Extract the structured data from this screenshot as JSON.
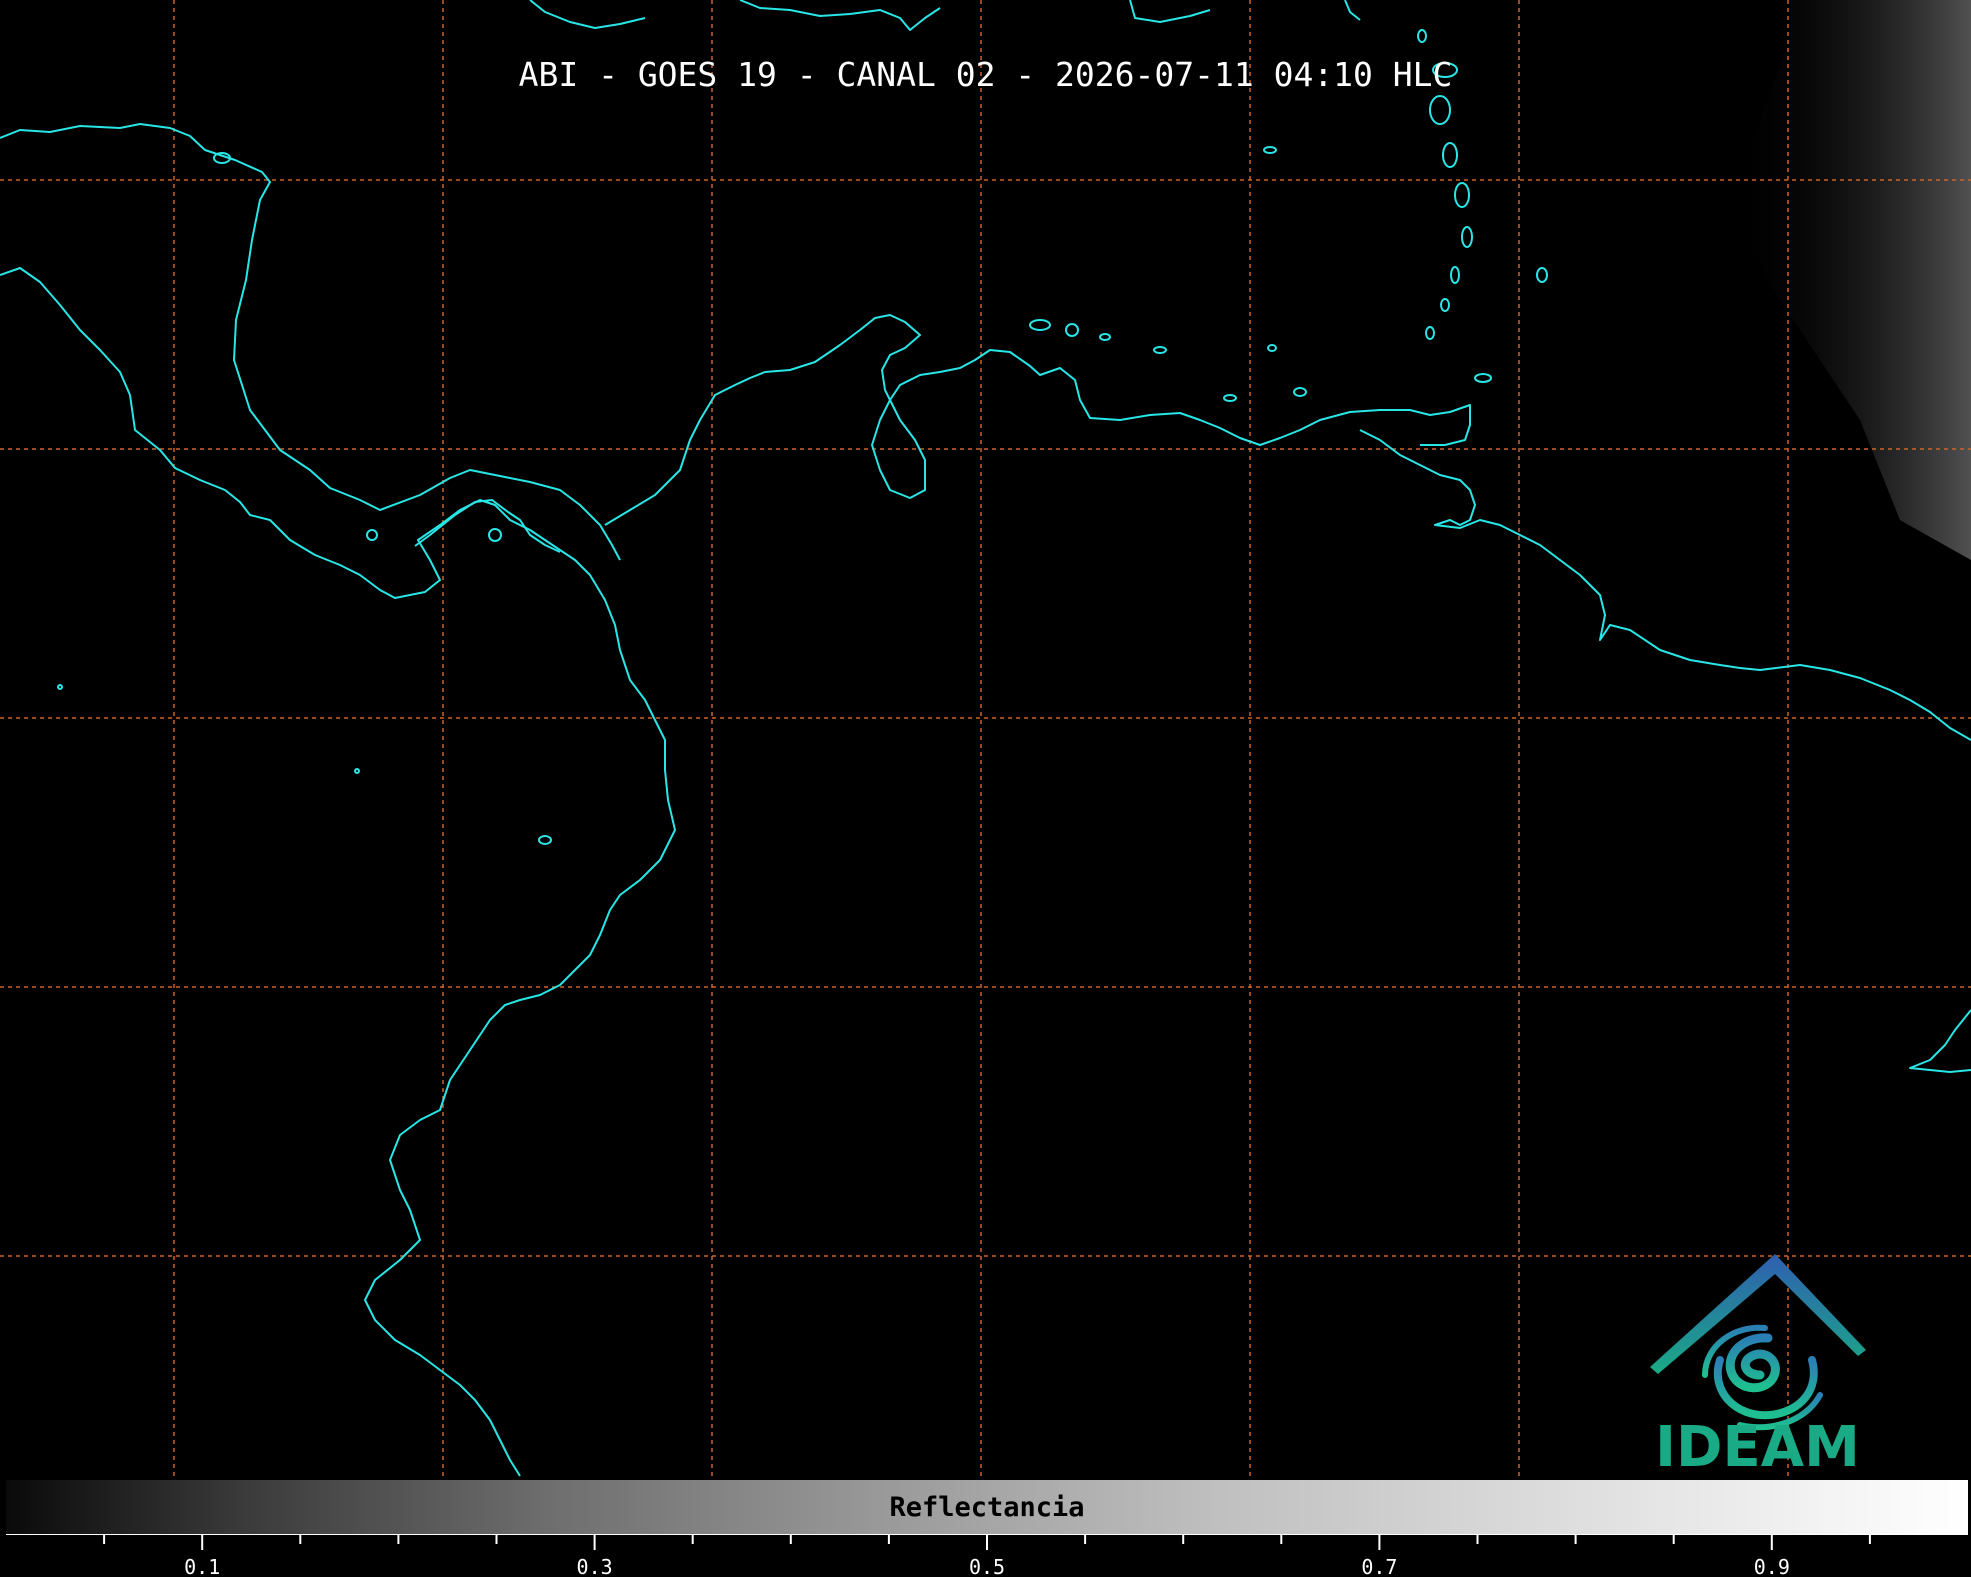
{
  "title": "ABI - GOES 19 - CANAL 02 - 2026-07-11 04:10 HLC",
  "colorbar": {
    "label": "Reflectancia",
    "ticks": [
      "0.1",
      "0.3",
      "0.5",
      "0.7",
      "0.9"
    ],
    "tick_values": [
      0.1,
      0.3,
      0.5,
      0.7,
      0.9
    ],
    "range": [
      0.0,
      1.0
    ]
  },
  "logo": {
    "text": "IDEAM"
  },
  "colors": {
    "background": "#000000",
    "coastline": "#29e6e6",
    "gridline": "#c8662a",
    "logo_primary": "#1aaa86",
    "logo_roof": "#2f6fb5"
  }
}
